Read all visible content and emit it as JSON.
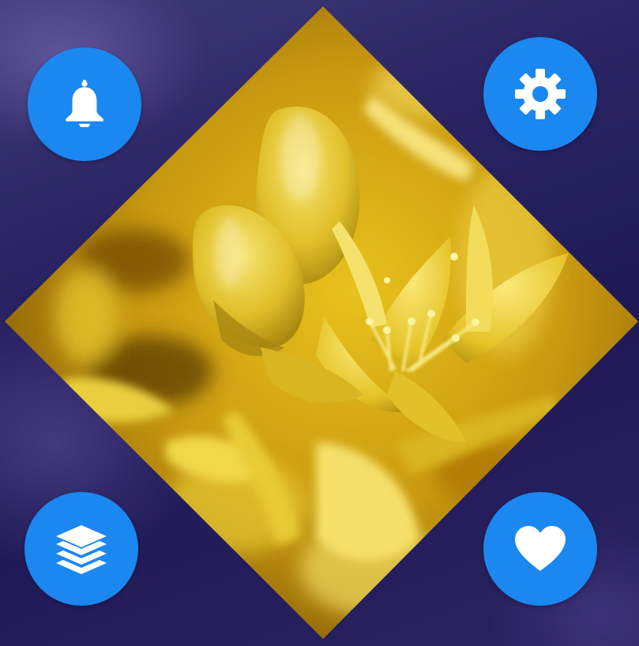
{
  "theme": {
    "background": "#241e5b",
    "accent": "#1b87f0",
    "icon_color": "#ffffff",
    "photo_tint": "#e9c81d"
  },
  "photo": {
    "subject": "yellow-flower-closeup"
  },
  "buttons": [
    {
      "id": "notifications",
      "icon": "bell-icon"
    },
    {
      "id": "settings",
      "icon": "gear-icon"
    },
    {
      "id": "layers",
      "icon": "layers-icon"
    },
    {
      "id": "favorite",
      "icon": "heart-icon"
    }
  ]
}
